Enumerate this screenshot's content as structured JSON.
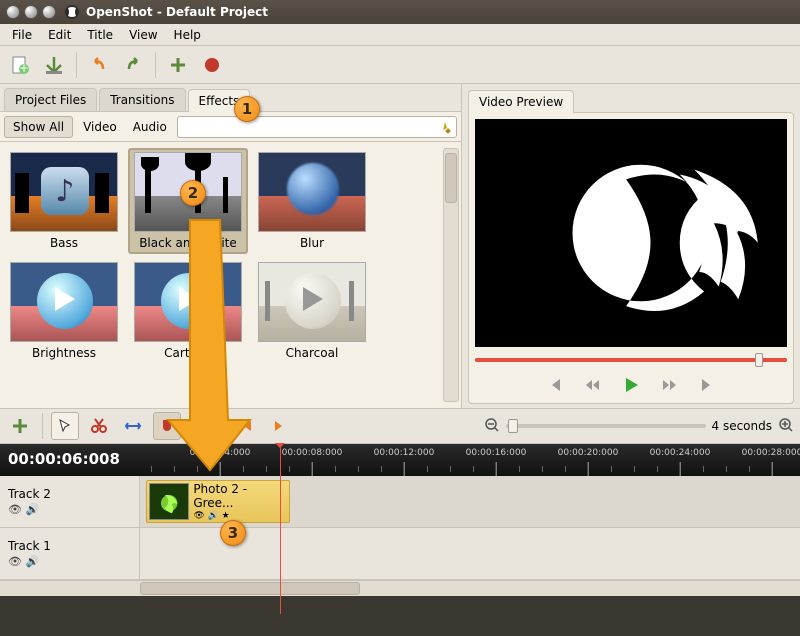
{
  "window": {
    "title": "OpenShot - Default Project"
  },
  "menu": {
    "file": "File",
    "edit": "Edit",
    "title": "Title",
    "view": "View",
    "help": "Help"
  },
  "tabs": {
    "project_files": "Project Files",
    "transitions": "Transitions",
    "effects": "Effects"
  },
  "filters": {
    "show_all": "Show All",
    "video": "Video",
    "audio": "Audio",
    "search_placeholder": ""
  },
  "effects": [
    {
      "name": "Bass"
    },
    {
      "name": "Black and White"
    },
    {
      "name": "Blur"
    },
    {
      "name": "Brightness"
    },
    {
      "name": "Cartoon"
    },
    {
      "name": "Charcoal"
    }
  ],
  "preview": {
    "tab": "Video Preview"
  },
  "timeline": {
    "current": "00:00:06:008",
    "ticks": [
      "00:00:04:000",
      "00:00:08:000",
      "00:00:12:000",
      "00:00:16:000",
      "00:00:20:000",
      "00:00:24:000",
      "00:00:28:000"
    ],
    "zoom_label": "4 seconds",
    "tracks": [
      {
        "name": "Track 2"
      },
      {
        "name": "Track 1"
      }
    ],
    "clip": {
      "title": "Photo 2 - Gree...",
      "icons": "👁 🔊 ★"
    }
  },
  "callouts": {
    "c1": "1",
    "c2": "2",
    "c3": "3"
  }
}
